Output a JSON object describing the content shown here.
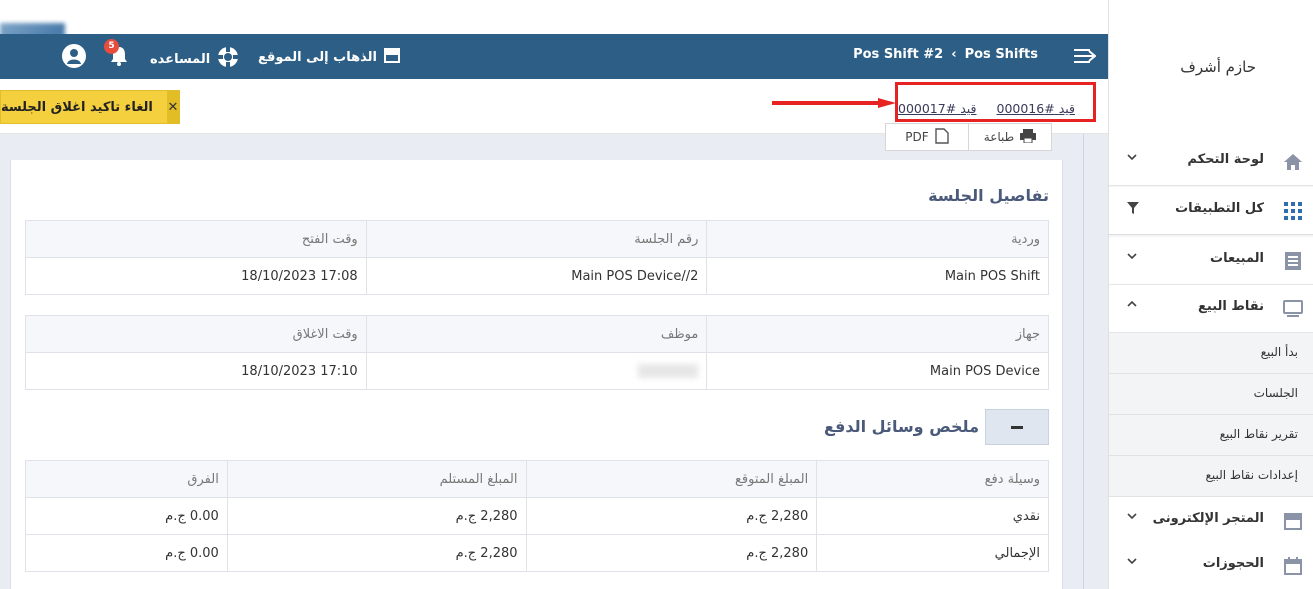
{
  "sidebar": {
    "user_name": "حازم أشرف",
    "items": [
      {
        "label": "لوحة التحكم",
        "icon": "home-icon",
        "expand": "collapsed"
      },
      {
        "label": "كل التطبيقات",
        "icon": "grid-icon",
        "expand": "filter"
      },
      {
        "label": "المبيعات",
        "icon": "receipt-icon",
        "expand": "collapsed"
      },
      {
        "label": "نقاط البيع",
        "icon": "monitor-icon",
        "expand": "expanded"
      },
      {
        "label": "المتجر الإلكترونى",
        "icon": "store-icon",
        "expand": "collapsed"
      },
      {
        "label": "الحجوزات",
        "icon": "calendar-icon",
        "expand": "collapsed"
      }
    ],
    "subitems": [
      "بدأ البيع",
      "الجلسات",
      "تقرير نقاط البيع",
      "إعدادات نقاط البيع"
    ]
  },
  "topbar": {
    "breadcrumb_parent": "Pos Shifts",
    "breadcrumb_current": "Pos Shift #2",
    "goto_site": "الذهاب إلى الموقع",
    "help": "المساعده",
    "notification_count": "5"
  },
  "subbar": {
    "cancel_label": "الغاء تاكيد اغلاق الجلسة",
    "entry_prefix": "قيد",
    "entry_links": [
      "#000016",
      "#000017"
    ]
  },
  "toolbar": {
    "print": "طباعة",
    "pdf": "PDF"
  },
  "session": {
    "title": "تفاصيل الجلسة",
    "table1_headers": [
      "وردية",
      "رقم الجلسة",
      "وقت الفتح"
    ],
    "table1_values": [
      "Main POS Shift",
      "Main POS Device//2",
      "17:08 18/10/2023"
    ],
    "table2_headers": [
      "جهاز",
      "موظف",
      "وقت الاغلاق"
    ],
    "table2_values": [
      "Main POS Device",
      "",
      "17:10 18/10/2023"
    ]
  },
  "payments": {
    "title": "ملخص وسائل الدفع",
    "headers": [
      "وسيلة دفع",
      "المبلغ المتوقع",
      "المبلغ المستلم",
      "الفرق"
    ],
    "rows": [
      [
        "نقدي",
        "2,280 ج.م",
        "2,280 ج.م",
        "0.00 ج.م"
      ],
      [
        "الإجمالي",
        "2,280 ج.م",
        "2,280 ج.م",
        "0.00 ج.م"
      ]
    ]
  },
  "colors": {
    "topbar": "#2d5f86",
    "cancel": "#f4d03f",
    "highlight": "#e62222"
  }
}
